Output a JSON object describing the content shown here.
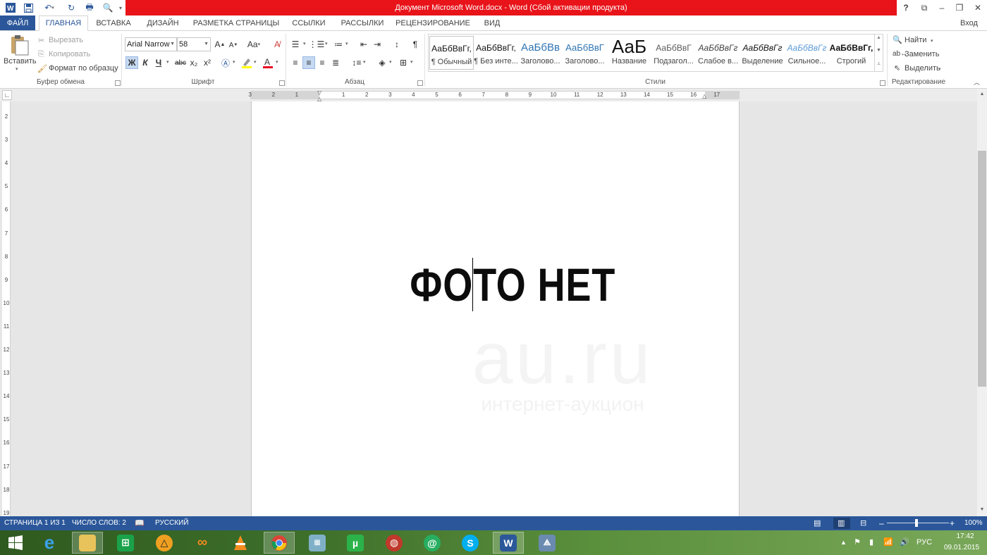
{
  "title_bar": {
    "title": "Документ Microsoft Word.docx - Word (Сбой активации продукта)",
    "help": "?",
    "login": "Вход"
  },
  "tabs": [
    {
      "label": "ФАЙЛ"
    },
    {
      "label": "ГЛАВНАЯ"
    },
    {
      "label": "ВСТАВКА"
    },
    {
      "label": "ДИЗАЙН"
    },
    {
      "label": "РАЗМЕТКА СТРАНИЦЫ"
    },
    {
      "label": "ССЫЛКИ"
    },
    {
      "label": "РАССЫЛКИ"
    },
    {
      "label": "РЕЦЕНЗИРОВАНИЕ"
    },
    {
      "label": "ВИД"
    }
  ],
  "clipboard": {
    "paste": "Вставить",
    "cut": "Вырезать",
    "copy": "Копировать",
    "format_painter": "Формат по образцу",
    "group": "Буфер обмена"
  },
  "font": {
    "name": "Arial Narrow",
    "size": "58",
    "bold": "Ж",
    "italic": "К",
    "underline": "Ч",
    "strike": "abc",
    "subscript": "x₂",
    "superscript": "x²",
    "case": "Aa",
    "group": "Шрифт"
  },
  "paragraph": {
    "group": "Абзац"
  },
  "styles": {
    "items": [
      {
        "preview": "АаБбВвГг,",
        "name": "¶ Обычный"
      },
      {
        "preview": "АаБбВвГг,",
        "name": "¶ Без инте..."
      },
      {
        "preview": "АаБбВв",
        "name": "Заголово..."
      },
      {
        "preview": "АаБбВвГ",
        "name": "Заголово..."
      },
      {
        "preview": "АаБ",
        "name": "Название"
      },
      {
        "preview": "АаБбВвГ",
        "name": "Подзагол..."
      },
      {
        "preview": "АаБбВвГг",
        "name": "Слабое в..."
      },
      {
        "preview": "АаБбВвГг",
        "name": "Выделение"
      },
      {
        "preview": "АаБбВвГг",
        "name": "Сильное..."
      },
      {
        "preview": "АаБбВвГг,",
        "name": "Строгий"
      }
    ],
    "group": "Стили"
  },
  "editing": {
    "find": "Найти",
    "replace": "Заменить",
    "select": "Выделить",
    "group": "Редактирование"
  },
  "ruler": {
    "h_ticks": [
      "3",
      "2",
      "1",
      "1",
      "2",
      "3",
      "4",
      "5",
      "6",
      "7",
      "8",
      "9",
      "10",
      "11",
      "12",
      "13",
      "14",
      "15",
      "16",
      "17"
    ],
    "v_ticks": [
      "2",
      "3",
      "4",
      "5",
      "6",
      "7",
      "8",
      "9",
      "10",
      "11",
      "12",
      "13",
      "14",
      "15",
      "16",
      "17",
      "18",
      "19"
    ]
  },
  "document": {
    "text": "ФОТО НЕТ",
    "watermark_logo": "au.ru",
    "watermark_text": "интернет-аукцион"
  },
  "status": {
    "page": "СТРАНИЦА 1 ИЗ 1",
    "words": "ЧИСЛО СЛОВ: 2",
    "language": "РУССКИЙ",
    "zoom": "100%"
  },
  "taskbar": {
    "lang": "РУС",
    "time": "17:42",
    "date": "09.01.2015"
  },
  "colors": {
    "accent": "#2b579a",
    "title_red": "#e8141a"
  }
}
